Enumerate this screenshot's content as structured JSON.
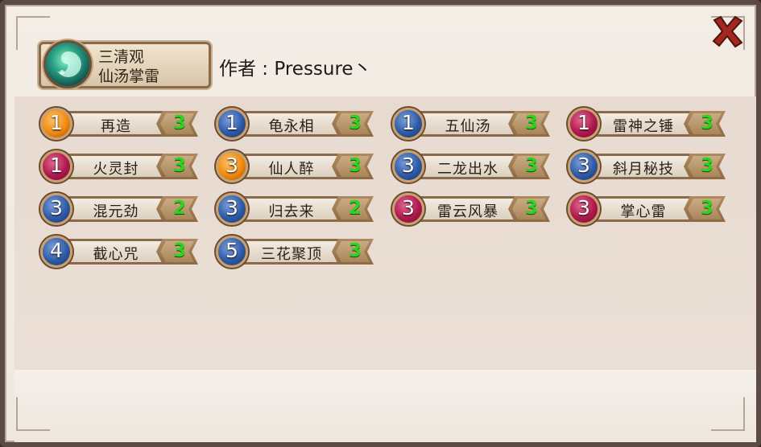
{
  "header": {
    "class_name": "三清观",
    "deck_name": "仙汤掌雷",
    "author": "作者 : Pressure丶"
  },
  "icons": {
    "class_emblem": "taoist-swirl-icon",
    "close": "close-x-icon"
  },
  "colors": {
    "gem_orange": "#f08a12",
    "gem_blue": "#2e5aa6",
    "gem_red": "#b0184e",
    "count_text": "#2fd21f",
    "close_red": "#a3271f"
  },
  "cards": [
    {
      "cost": "1",
      "name": "再造",
      "count": "3",
      "gem": "orange"
    },
    {
      "cost": "1",
      "name": "龟永相",
      "count": "3",
      "gem": "blue"
    },
    {
      "cost": "1",
      "name": "五仙汤",
      "count": "3",
      "gem": "blue"
    },
    {
      "cost": "1",
      "name": "雷神之锤",
      "count": "3",
      "gem": "red"
    },
    {
      "cost": "1",
      "name": "火灵封",
      "count": "3",
      "gem": "red"
    },
    {
      "cost": "3",
      "name": "仙人醉",
      "count": "3",
      "gem": "orange"
    },
    {
      "cost": "3",
      "name": "二龙出水",
      "count": "3",
      "gem": "blue"
    },
    {
      "cost": "3",
      "name": "斜月秘技",
      "count": "3",
      "gem": "blue"
    },
    {
      "cost": "3",
      "name": "混元劲",
      "count": "2",
      "gem": "blue"
    },
    {
      "cost": "3",
      "name": "归去来",
      "count": "2",
      "gem": "blue"
    },
    {
      "cost": "3",
      "name": "雷云风暴",
      "count": "3",
      "gem": "red"
    },
    {
      "cost": "3",
      "name": "掌心雷",
      "count": "3",
      "gem": "red"
    },
    {
      "cost": "4",
      "name": "截心咒",
      "count": "3",
      "gem": "blue"
    },
    {
      "cost": "5",
      "name": "三花聚顶",
      "count": "3",
      "gem": "blue"
    }
  ]
}
